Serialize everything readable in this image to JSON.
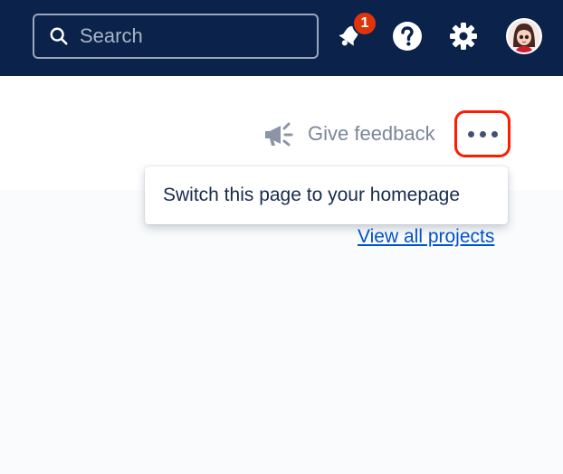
{
  "header": {
    "search_placeholder": "Search",
    "notification_count": "1",
    "icons": [
      "search-icon",
      "bell-icon",
      "help-icon",
      "gear-icon",
      "avatar"
    ]
  },
  "toolbar": {
    "feedback_label": "Give feedback",
    "more_icon": "more-horizontal-icon"
  },
  "menu": {
    "items": [
      "Switch this page to your homepage"
    ]
  },
  "links": {
    "view_all_projects": "View all projects"
  },
  "colors": {
    "topbar": "#0b224b",
    "badge": "#de350b",
    "highlight": "#ff1b00",
    "link": "#0052cc"
  }
}
